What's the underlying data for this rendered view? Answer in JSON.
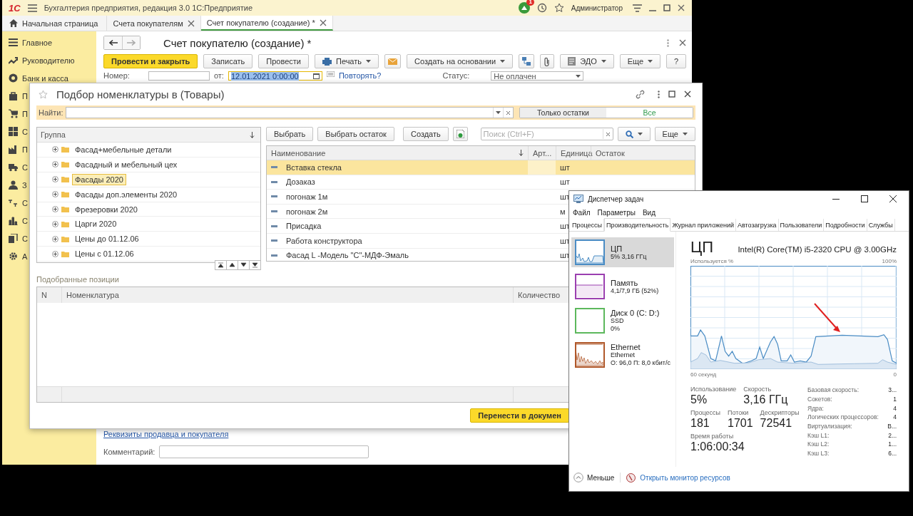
{
  "main_window": {
    "logo": "1С",
    "title": "Бухгалтерия предприятия, редакция 3.0 1С:Предприятие",
    "notification_count": "1",
    "user": "Администратор",
    "tabs": [
      {
        "label": "Начальная страница",
        "kind": "home",
        "selected": false
      },
      {
        "label": "Счета покупателям",
        "kind": "document",
        "selected": false
      },
      {
        "label": "Счет покупателю (создание) *",
        "kind": "document",
        "selected": true
      }
    ],
    "sidebar": [
      {
        "label": "Главное",
        "kind": "list"
      },
      {
        "label": "Руководителю",
        "kind": "trend"
      },
      {
        "label": "Банк и касса",
        "kind": "coin"
      },
      {
        "label": "П",
        "kind": "bag"
      },
      {
        "label": "П",
        "kind": "cart"
      },
      {
        "label": "С",
        "kind": "grid"
      },
      {
        "label": "П",
        "kind": "factory"
      },
      {
        "label": "С",
        "kind": "truck"
      },
      {
        "label": "З",
        "kind": "person"
      },
      {
        "label": "С",
        "kind": "ledger"
      },
      {
        "label": "С",
        "kind": "bars"
      },
      {
        "label": "С",
        "kind": "books"
      },
      {
        "label": "А",
        "kind": "gear"
      }
    ],
    "form_title": "Счет покупателю (создание) *",
    "toolbar": [
      {
        "label": "Провести и закрыть",
        "kind": "primary"
      },
      {
        "label": "Записать",
        "kind": "plain"
      },
      {
        "label": "Провести",
        "kind": "plain"
      },
      {
        "label": "Печать",
        "kind": "print"
      },
      {
        "kind": "mail"
      },
      {
        "label": "Создать на основании",
        "kind": "dropdown"
      },
      {
        "kind": "structure"
      },
      {
        "kind": "attach"
      },
      {
        "label": "ЭДО",
        "kind": "edo"
      },
      {
        "label": "Еще",
        "kind": "dropdown"
      },
      {
        "label": "?",
        "kind": "plain"
      }
    ],
    "number_label": "Номер:",
    "date_label": "от:",
    "date_value": "12.01.2021  0:00:00",
    "repeat_link": "Повторять?",
    "status_label": "Статус:",
    "status_value": "Не оплачен",
    "details_link": "Реквизиты продавца и покупателя",
    "comment_label": "Комментарий:"
  },
  "picker_dialog": {
    "title": "Подбор номенклатуры в  (Товары)",
    "search_label": "Найти:",
    "filter_toggle": [
      {
        "label": "Только остатки",
        "selected": false
      },
      {
        "label": "Все",
        "selected": true
      }
    ],
    "tree": {
      "column": "Группа",
      "rows": [
        {
          "label": "Фасад+мебельные детали",
          "expanded": false,
          "selected": false
        },
        {
          "label": "Фасадный и мебельный цех",
          "expanded": false,
          "selected": false
        },
        {
          "label": "Фасады 2020",
          "expanded": false,
          "selected": true
        },
        {
          "label": "Фасады доп.элементы 2020",
          "expanded": false,
          "selected": false
        },
        {
          "label": "Фрезеровки 2020",
          "expanded": false,
          "selected": false
        },
        {
          "label": "Царги 2020",
          "expanded": false,
          "selected": false
        },
        {
          "label": "Цены до 01.12.06",
          "expanded": false,
          "selected": false
        },
        {
          "label": "Цены с 01.12.06",
          "expanded": false,
          "selected": false
        }
      ]
    },
    "list_toolbar": [
      "Выбрать",
      "Выбрать остаток",
      "Создать"
    ],
    "search_placeholder": "Поиск (Ctrl+F)",
    "more_label": "Еще",
    "items": {
      "columns": [
        "Наименование",
        "Арт...",
        "Единица",
        "Остаток"
      ],
      "rows": [
        {
          "name": "Вставка стекла",
          "unit": "шт",
          "selected": true
        },
        {
          "name": "Дозаказ",
          "unit": "шт",
          "selected": false
        },
        {
          "name": "погонаж 1м",
          "unit": "шт",
          "selected": false
        },
        {
          "name": "погонаж 2м",
          "unit": "м",
          "selected": false
        },
        {
          "name": "Присадка",
          "unit": "шт",
          "selected": false
        },
        {
          "name": "Работа конструктора",
          "unit": "шт",
          "selected": false
        },
        {
          "name": "Фасад L -Модель \"С\"-МДФ-Эмаль",
          "unit": "шт",
          "selected": false
        }
      ]
    },
    "picked_label": "Подобранные позиции",
    "picked_columns": [
      "N",
      "Номенклатура",
      "Количество"
    ],
    "transfer_button": "Перенести в докумен"
  },
  "task_manager": {
    "title": "Диспетчер задач",
    "menu": [
      "Файл",
      "Параметры",
      "Вид"
    ],
    "tabs": [
      {
        "label": "Процессы",
        "selected": false
      },
      {
        "label": "Производительность",
        "selected": true
      },
      {
        "label": "Журнал приложений",
        "selected": false
      },
      {
        "label": "Автозагрузка",
        "selected": false
      },
      {
        "label": "Пользователи",
        "selected": false
      },
      {
        "label": "Подробности",
        "selected": false
      },
      {
        "label": "Службы",
        "selected": false
      }
    ],
    "resources": [
      {
        "name": "ЦП",
        "lines": [
          "5% 3,16 ГГц"
        ],
        "kind": "cpu",
        "color": "#4a8cc4",
        "selected": true
      },
      {
        "name": "Память",
        "lines": [
          "4,1/7,9 ГБ (52%)"
        ],
        "kind": "memory",
        "color": "#9b3fb0",
        "selected": false
      },
      {
        "name": "Диск 0 (C: D:)",
        "lines": [
          "SSD",
          "0%"
        ],
        "kind": "disk",
        "color": "#5cb85c",
        "selected": false
      },
      {
        "name": "Ethernet",
        "lines": [
          "Ethernet",
          "О: 96,0 П: 8,0 кбит/с"
        ],
        "kind": "network",
        "color": "#b0582a",
        "selected": false
      }
    ],
    "heading": "ЦП",
    "cpu_model": "Intel(R) Core(TM) i5-2320 CPU @ 3.00GHz",
    "graph_label": "Используется %",
    "graph_max": "100%",
    "graph_time": "60 секунд",
    "graph_min": "0",
    "stats": [
      [
        {
          "label": "Использование",
          "value": "5%"
        },
        {
          "label": "Скорость",
          "value": "3,16 ГГц"
        }
      ],
      [
        {
          "label": "Процессы",
          "value": "181"
        },
        {
          "label": "Потоки",
          "value": "1701"
        },
        {
          "label": "Дескрипторы",
          "value": "72541"
        }
      ],
      [
        {
          "label": "Время работы",
          "value": "1:06:00:34"
        }
      ]
    ],
    "details": [
      {
        "label": "Базовая скорость:",
        "value": "3..."
      },
      {
        "label": "Сокетов:",
        "value": "1"
      },
      {
        "label": "Ядра:",
        "value": "4"
      },
      {
        "label": "Логических процессоров:",
        "value": "4"
      },
      {
        "label": "Виртуализация:",
        "value": "В..."
      },
      {
        "label": "Кэш L1:",
        "value": "2..."
      },
      {
        "label": "Кэш L2:",
        "value": "1..."
      },
      {
        "label": "Кэш L3:",
        "value": "6..."
      }
    ],
    "fewer_label": "Меньше",
    "monitor_link": "Открыть монитор ресурсов"
  }
}
